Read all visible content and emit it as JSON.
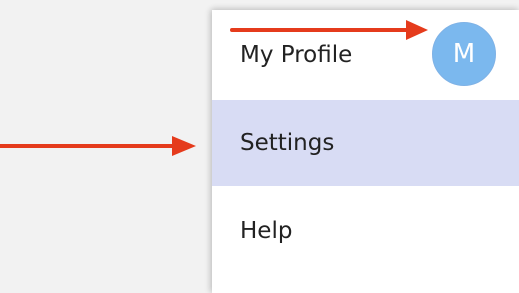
{
  "menu": {
    "items": [
      {
        "label": "My Profile"
      },
      {
        "label": "Settings",
        "active": true
      },
      {
        "label": "Help"
      }
    ]
  },
  "avatar": {
    "initial": "M",
    "color": "#7bb8ee"
  },
  "annotations": {
    "arrow_color": "#e53b1c",
    "arrows": [
      {
        "target": "avatar",
        "icon": "arrow-right-icon"
      },
      {
        "target": "settings",
        "icon": "arrow-right-icon"
      }
    ]
  }
}
